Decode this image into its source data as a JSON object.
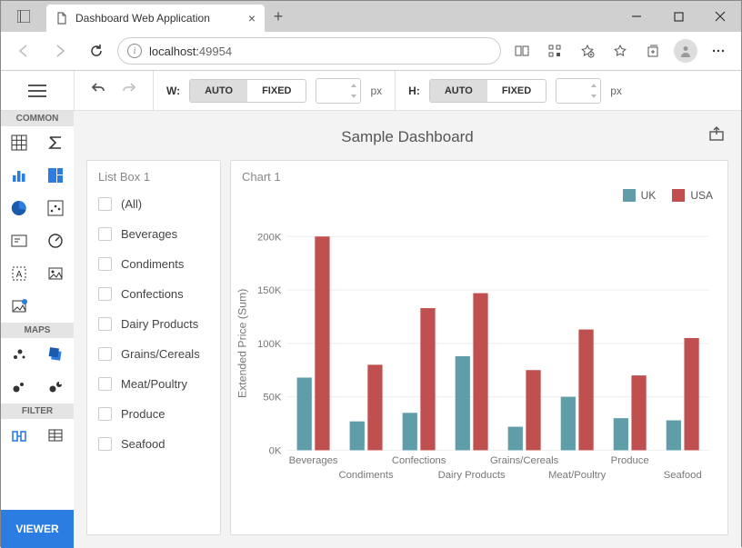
{
  "browser": {
    "tab_title": "Dashboard Web Application",
    "url_host": "localhost:",
    "url_port": "49954"
  },
  "toolbar": {
    "width_label": "W:",
    "height_label": "H:",
    "auto": "AUTO",
    "fixed": "FIXED",
    "unit": "px"
  },
  "sidebar": {
    "sections": {
      "common": "COMMON",
      "maps": "MAPS",
      "filter": "FILTER"
    },
    "viewer": "VIEWER"
  },
  "dashboard": {
    "title": "Sample Dashboard"
  },
  "listbox": {
    "title": "List Box 1",
    "items": [
      "(All)",
      "Beverages",
      "Condiments",
      "Confections",
      "Dairy Products",
      "Grains/Cereals",
      "Meat/Poultry",
      "Produce",
      "Seafood"
    ]
  },
  "chart": {
    "title": "Chart 1"
  },
  "chart_data": {
    "type": "bar",
    "title": "Chart 1",
    "ylabel": "Extended Price (Sum)",
    "xlabel": "",
    "ylim": [
      0,
      200000
    ],
    "yticks": [
      "0K",
      "50K",
      "100K",
      "150K",
      "200K"
    ],
    "categories": [
      "Beverages",
      "Condiments",
      "Confections",
      "Dairy Products",
      "Grains/Cereals",
      "Meat/Poultry",
      "Produce",
      "Seafood"
    ],
    "series": [
      {
        "name": "UK",
        "color": "#5f9ea8",
        "values": [
          68000,
          27000,
          35000,
          88000,
          22000,
          50000,
          30000,
          28000
        ]
      },
      {
        "name": "USA",
        "color": "#c05050",
        "values": [
          200000,
          80000,
          133000,
          147000,
          75000,
          113000,
          70000,
          105000
        ]
      }
    ],
    "legend_position": "top-right"
  }
}
